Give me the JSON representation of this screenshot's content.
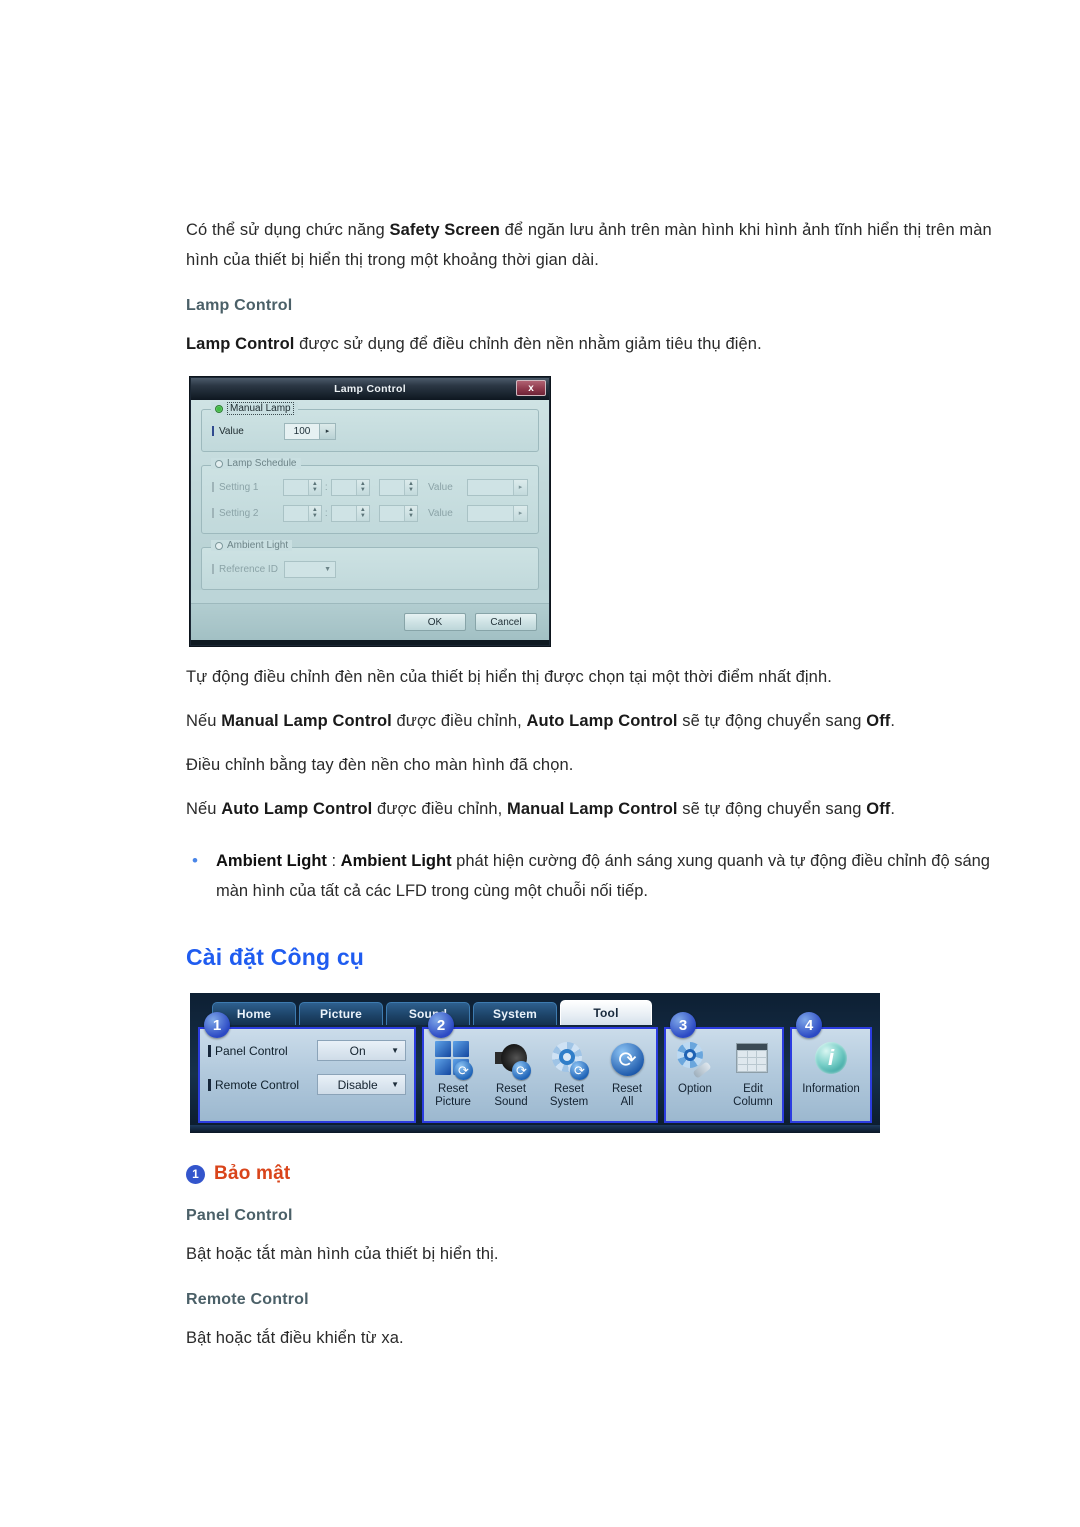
{
  "page": {
    "intro_paragraph_prefix": "Có thể sử dụng chức năng ",
    "intro_bold": "Safety Screen",
    "intro_paragraph_suffix": " để ngăn lưu ảnh trên màn hình khi hình ảnh tĩnh hiển thị trên màn hình của thiết bị hiển thị trong một khoảng thời gian dài."
  },
  "lamp_section": {
    "subhead": "Lamp Control",
    "desc_bold": "Lamp Control",
    "desc_rest": " được sử dụng để điều chỉnh đèn nền nhằm giảm tiêu thụ điện."
  },
  "dialog": {
    "title": "Lamp Control",
    "close_label": "x",
    "manual": {
      "legend": "Manual Lamp",
      "value_label": "Value",
      "value": "100",
      "spin_arrow": "▸"
    },
    "schedule": {
      "legend": "Lamp Schedule",
      "rows": [
        {
          "label": "Setting 1",
          "h": "",
          "m": "",
          "s": "",
          "value_label": "Value",
          "value": ""
        },
        {
          "label": "Setting 2",
          "h": "",
          "m": "",
          "s": "",
          "value_label": "Value",
          "value": ""
        }
      ],
      "colon": ":",
      "arrow": "▸",
      "stepper_up": "▲",
      "stepper_down": "▼"
    },
    "ambient": {
      "legend": "Ambient Light",
      "reference_label": "Reference ID",
      "reference_value": "",
      "caret": "▼"
    },
    "buttons": {
      "ok": "OK",
      "cancel": "Cancel"
    }
  },
  "notes": [
    {
      "text": "Tự động điều chỉnh đèn nền của thiết bị hiển thị được chọn tại một thời điểm nhất định."
    },
    {
      "parts": [
        {
          "t": "Nếu ",
          "b": false
        },
        {
          "t": "Manual Lamp Control",
          "b": true
        },
        {
          "t": " được điều chỉnh, ",
          "b": false
        },
        {
          "t": "Auto Lamp Control",
          "b": true
        },
        {
          "t": " sẽ tự động chuyển sang ",
          "b": false
        },
        {
          "t": "Off",
          "b": true
        },
        {
          "t": ".",
          "b": false
        }
      ]
    },
    {
      "text": "Điều chỉnh bằng tay đèn nền cho màn hình đã chọn."
    },
    {
      "parts": [
        {
          "t": "Nếu ",
          "b": false
        },
        {
          "t": "Auto Lamp Control",
          "b": true
        },
        {
          "t": " được điều chỉnh, ",
          "b": false
        },
        {
          "t": "Manual Lamp Control",
          "b": true
        },
        {
          "t": " sẽ tự động chuyển sang ",
          "b": false
        },
        {
          "t": "Off",
          "b": true
        },
        {
          "t": ".",
          "b": false
        }
      ]
    }
  ],
  "bullet": {
    "marker": "•",
    "bold_a": "Ambient Light",
    "sep": " : ",
    "bold_b": "Ambient Light",
    "rest": " phát hiện cường độ ánh sáng xung quanh và tự động điều chỉnh độ sáng màn hình của tất cả các LFD trong cùng một chuỗi nối tiếp."
  },
  "tool_heading": "Cài đặt Công cụ",
  "ribbon": {
    "tabs": [
      {
        "label": "Home",
        "active": false
      },
      {
        "label": "Picture",
        "active": false
      },
      {
        "label": "Sound",
        "active": false
      },
      {
        "label": "System",
        "active": false
      },
      {
        "label": "Tool",
        "active": true
      }
    ],
    "panel1": {
      "badge": "1",
      "rows": [
        {
          "label": "Panel Control",
          "value": "On",
          "caret": "▼"
        },
        {
          "label": "Remote Control",
          "value": "Disable",
          "caret": "▼"
        }
      ]
    },
    "panel2": {
      "badge": "2",
      "items": [
        {
          "line1": "Reset",
          "line2": "Picture",
          "icon": "reset-picture-icon"
        },
        {
          "line1": "Reset",
          "line2": "Sound",
          "icon": "reset-sound-icon"
        },
        {
          "line1": "Reset",
          "line2": "System",
          "icon": "reset-system-icon"
        },
        {
          "line1": "Reset",
          "line2": "All",
          "icon": "reset-all-icon"
        }
      ]
    },
    "panel3": {
      "badge": "3",
      "items": [
        {
          "line1": "Option",
          "line2": "",
          "icon": "option-gear-icon"
        },
        {
          "line1": "Edit",
          "line2": "Column",
          "icon": "edit-column-icon"
        }
      ]
    },
    "panel4": {
      "badge": "4",
      "items": [
        {
          "line1": "Information",
          "line2": "",
          "icon": "information-icon"
        }
      ]
    }
  },
  "security": {
    "badge": "1",
    "heading": "Bảo mật",
    "items": [
      {
        "title": "Panel Control",
        "body": "Bật hoặc tắt màn hình của thiết bị hiển thị."
      },
      {
        "title": "Remote Control",
        "body": "Bật hoặc tắt điều khiển từ xa."
      }
    ]
  },
  "colors": {
    "heading_blue": "#1f5cf0",
    "heading_orange": "#d9441a",
    "subhead_slate": "#4b6068",
    "badge_blue": "#3355cc",
    "panel_outline": "#2b3ce0"
  }
}
